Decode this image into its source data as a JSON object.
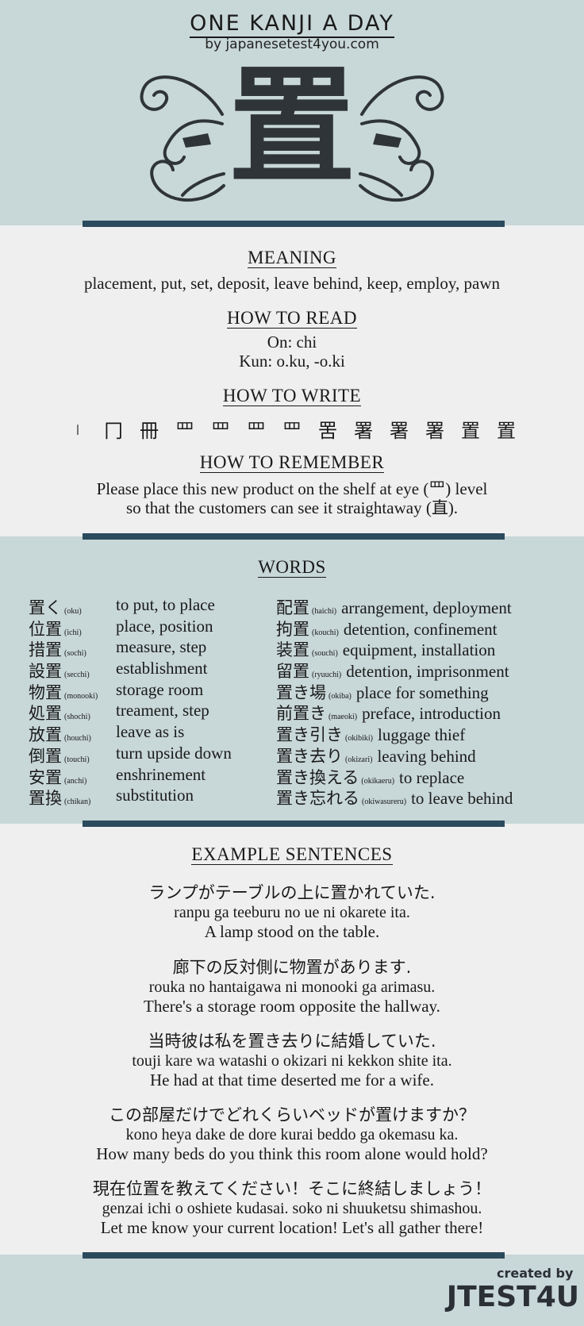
{
  "header": {
    "title": "ONE KANJI A DAY",
    "subtitle": "by japanesetest4you.com",
    "kanji": "置"
  },
  "meaning": {
    "heading": "MEANING",
    "text": "placement, put, set, deposit, leave behind, keep, employ, pawn"
  },
  "how_to_read": {
    "heading": "HOW TO READ",
    "on": "On: chi",
    "kun": "Kun: o.ku, -o.ki"
  },
  "how_to_write": {
    "heading": "HOW TO WRITE",
    "steps": [
      "丨",
      "冂",
      "冊",
      "罒",
      "罒",
      "罒",
      "罒",
      "罟",
      "署",
      "署",
      "署",
      "置",
      "置"
    ]
  },
  "how_to_remember": {
    "heading": "HOW TO REMEMBER",
    "line1": "Please place this new product on the shelf at eye (罒) level",
    "line2": "so that the customers can see it straightaway (直)."
  },
  "words": {
    "heading": "WORDS",
    "left": [
      {
        "kanji": "置く",
        "reading": "(oku)",
        "meaning": "to put, to place"
      },
      {
        "kanji": "位置",
        "reading": "(ichi)",
        "meaning": "place, position"
      },
      {
        "kanji": "措置",
        "reading": "(sochi)",
        "meaning": "measure, step"
      },
      {
        "kanji": "設置",
        "reading": "(secchi)",
        "meaning": "establishment"
      },
      {
        "kanji": "物置",
        "reading": "(monooki)",
        "meaning": "storage room"
      },
      {
        "kanji": "処置",
        "reading": "(shochi)",
        "meaning": "treament, step"
      },
      {
        "kanji": "放置",
        "reading": "(houchi)",
        "meaning": "leave as is"
      },
      {
        "kanji": "倒置",
        "reading": "(touchi)",
        "meaning": "turn upside down"
      },
      {
        "kanji": "安置",
        "reading": "(anchi)",
        "meaning": "enshrinement"
      },
      {
        "kanji": "置換",
        "reading": "(chikan)",
        "meaning": "substitution"
      }
    ],
    "right": [
      {
        "kanji": "配置",
        "reading": "(haichi)",
        "meaning": "arrangement, deployment"
      },
      {
        "kanji": "拘置",
        "reading": "(kouchi)",
        "meaning": "detention, confinement"
      },
      {
        "kanji": "装置",
        "reading": "(souchi)",
        "meaning": "equipment, installation"
      },
      {
        "kanji": "留置",
        "reading": "(ryuuchi)",
        "meaning": "detention, imprisonment"
      },
      {
        "kanji": "置き場",
        "reading": "(okiba)",
        "meaning": "place for something"
      },
      {
        "kanji": "前置き",
        "reading": "(maeoki)",
        "meaning": "preface, introduction"
      },
      {
        "kanji": "置き引き",
        "reading": "(okibiki)",
        "meaning": "luggage thief"
      },
      {
        "kanji": "置き去り",
        "reading": "(okizari)",
        "meaning": "leaving behind"
      },
      {
        "kanji": "置き換える",
        "reading": "(okikaeru)",
        "meaning": "to replace"
      },
      {
        "kanji": "置き忘れる",
        "reading": "(okiwasureru)",
        "meaning": "to leave behind"
      }
    ]
  },
  "examples": {
    "heading": "EXAMPLE SENTENCES",
    "items": [
      {
        "jp": "ランプがテーブルの上に置かれていた.",
        "romaji": "ranpu ga teeburu no ue ni okarete ita.",
        "en": "A lamp stood on the table."
      },
      {
        "jp": "廊下の反対側に物置があります.",
        "romaji": "rouka no hantaigawa ni monooki ga arimasu.",
        "en": "There's a storage room opposite the hallway."
      },
      {
        "jp": "当時彼は私を置き去りに結婚していた.",
        "romaji": "touji kare wa watashi o okizari ni kekkon shite ita.",
        "en": "He had at that time deserted me for a wife."
      },
      {
        "jp": "この部屋だけでどれくらいベッドが置けますか？",
        "romaji": "kono heya dake de dore kurai beddo ga okemasu ka.",
        "en": "How many beds do you think this room alone would hold?"
      },
      {
        "jp": "現在位置を教えてください！そこに終結しましょう！",
        "romaji": "genzai ichi o oshiete kudasai. soko ni shuuketsu shimashou.",
        "en": "Let me know your current location! Let's all gather there!"
      }
    ]
  },
  "credit": {
    "small": "created by",
    "big": "JTEST4U"
  }
}
